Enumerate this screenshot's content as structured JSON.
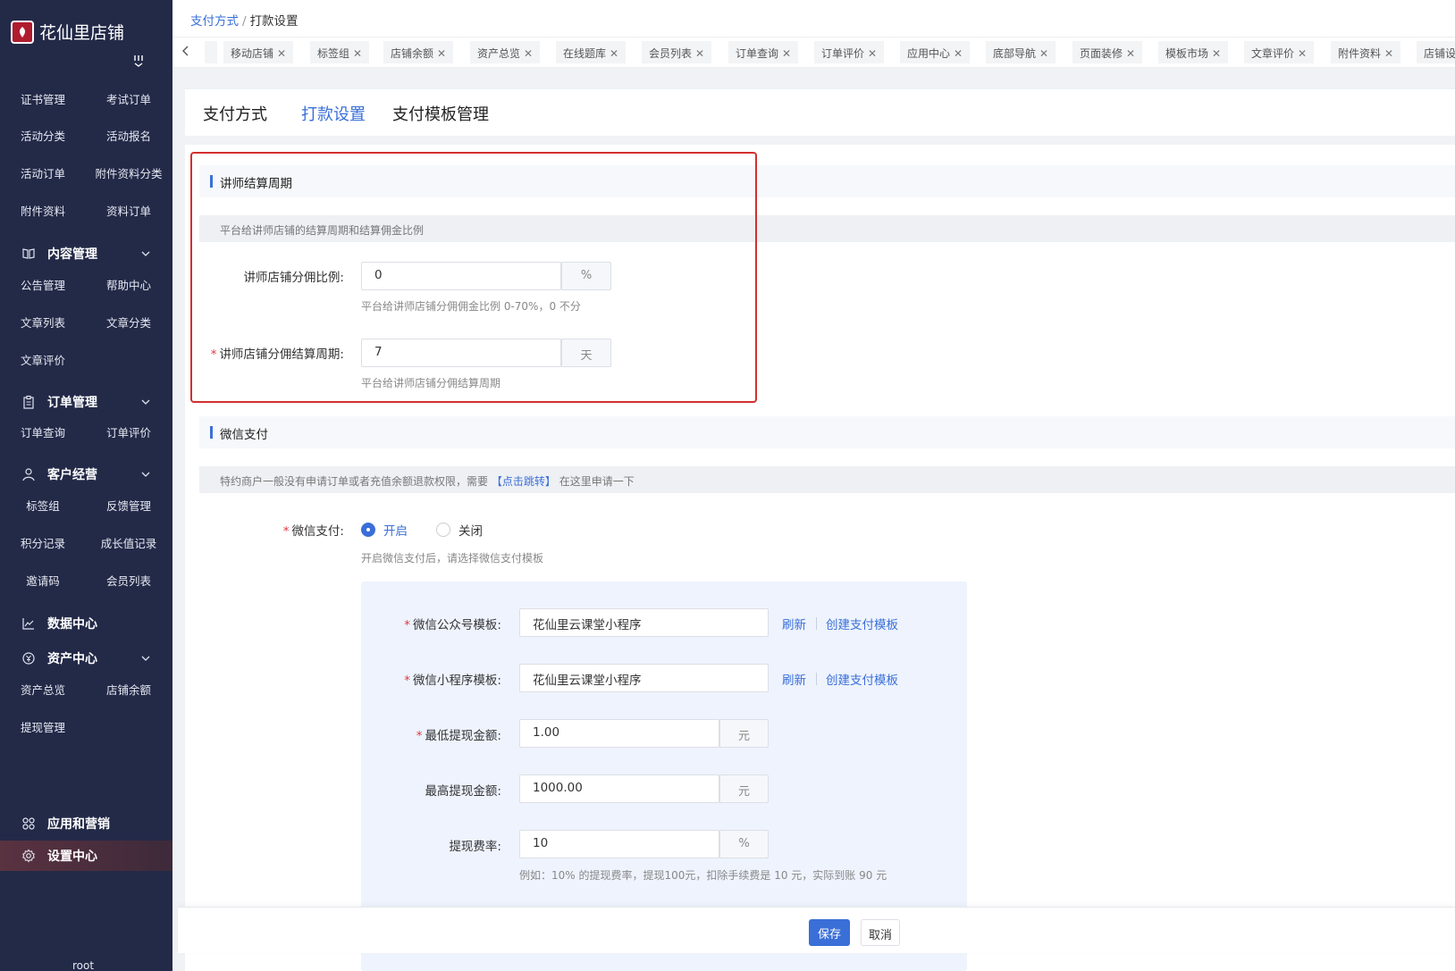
{
  "sidebar": {
    "brand": "花仙里店铺",
    "logo_text": "花仙里",
    "rows": [
      [
        "证书管理",
        "考试订单"
      ],
      [
        "活动分类",
        "活动报名"
      ],
      [
        "活动订单",
        "附件资料分类"
      ],
      [
        "附件资料",
        "资料订单"
      ],
      [
        "公告管理",
        "帮助中心"
      ],
      [
        "文章列表",
        "文章分类"
      ],
      [
        "文章评价",
        ""
      ],
      [
        "订单查询",
        "订单评价"
      ],
      [
        "标签组",
        "反馈管理"
      ],
      [
        "积分记录",
        "成长值记录"
      ],
      [
        "邀请码",
        "会员列表"
      ],
      [
        "资产总览",
        "店铺余额"
      ],
      [
        "提现管理",
        ""
      ]
    ],
    "groups": {
      "content": "内容管理",
      "order": "订单管理",
      "customer": "客户经营",
      "data": "数据中心",
      "asset": "资产中心",
      "apps": "应用和营销",
      "settings": "设置中心"
    },
    "user": "root"
  },
  "breadcrumb": {
    "parent": "支付方式",
    "separator": "/",
    "current": "打款设置"
  },
  "open_tabs": [
    "移动店铺",
    "标签组",
    "店铺余额",
    "资产总览",
    "在线题库",
    "会员列表",
    "订单查询",
    "订单评价",
    "应用中心",
    "底部导航",
    "页面装修",
    "模板市场",
    "文章评价",
    "附件资料",
    "店铺设"
  ],
  "page_tabs": [
    "支付方式",
    "打款设置",
    "支付模板管理"
  ],
  "lecturer": {
    "title": "讲师结算周期",
    "note": "平台给讲师店铺的结算周期和结算佣金比例",
    "ratio_label": "讲师店铺分佣比例:",
    "ratio_value": "0",
    "ratio_unit": "%",
    "ratio_help": "平台给讲师店铺分佣佣金比例 0-70%，0 不分",
    "period_label": "讲师店铺分佣结算周期:",
    "period_value": "7",
    "period_unit": "天",
    "period_help": "平台给讲师店铺分佣结算周期",
    "required_mark": "*"
  },
  "wechat": {
    "title": "微信支付",
    "note_prefix": "特约商户一般没有申请订单或者充值余额退款权限，需要",
    "note_link": "【点击跳转】",
    "note_suffix": "在这里申请一下",
    "pay_label": "微信支付:",
    "on_label": "开启",
    "off_label": "关闭",
    "pay_help": "开启微信支付后，请选择微信支付模板",
    "mp_label": "微信公众号模板:",
    "mp_value": "花仙里云课堂小程序",
    "mini_label": "微信小程序模板:",
    "mini_value": "花仙里云课堂小程序",
    "refresh": "刷新",
    "create_template": "创建支付模板",
    "min_label": "最低提现金额:",
    "min_value": "1.00",
    "max_label": "最高提现金额:",
    "max_value": "1000.00",
    "currency_unit": "元",
    "fee_label": "提现费率:",
    "fee_value": "10",
    "fee_unit": "%",
    "fee_help": "例如：10% 的提现费率，提现100元，扣除手续费是 10 元，实际到账 90 元"
  },
  "footer": {
    "save": "保存",
    "cancel": "取消"
  },
  "colors": {
    "accent": "#3a6fd8",
    "sidebar_bg": "#232a48",
    "highlight_border": "#d32f2f",
    "required": "#e0383e"
  }
}
